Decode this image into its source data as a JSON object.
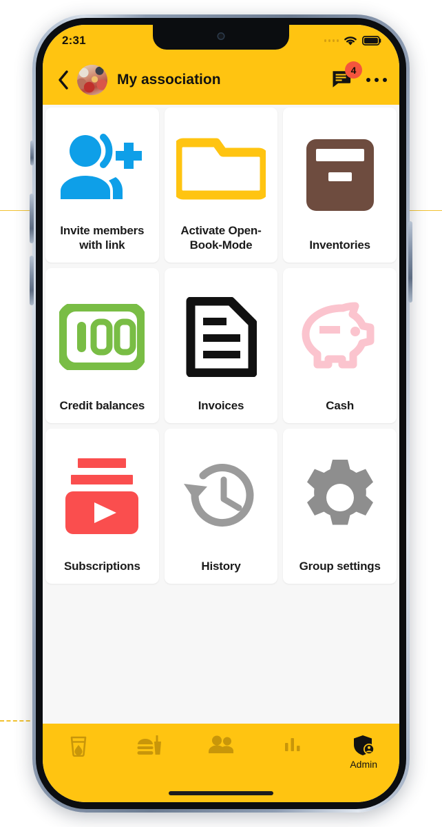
{
  "colors": {
    "brand": "#FFC411",
    "badge": "#F4553D",
    "tile_bg": "#FFFFFF",
    "screen_bg": "#F7F7F7",
    "invite_icon": "#0E9FE8",
    "folder_icon": "#FFC411",
    "inventory_icon": "#6E4C3F",
    "credit_icon": "#79BD45",
    "invoice_icon": "#111111",
    "cash_icon": "#FBC4CE",
    "subscriptions_icon": "#FA4E4E",
    "history_icon": "#9B9B9B",
    "settings_icon": "#8E8E8E",
    "nav_inactive": "#C8960A",
    "nav_active": "#121212"
  },
  "statusbar": {
    "time": "2:31",
    "signal_icon": "signal-dots-icon",
    "wifi_icon": "wifi-icon",
    "battery_icon": "battery-full-icon"
  },
  "appbar": {
    "back_icon": "back-chevron-icon",
    "avatar_icon": "group-avatar-photo",
    "title": "My association",
    "chat_icon": "chat-bubble-icon",
    "chat_badge_count": "4",
    "overflow_icon": "more-horizontal-icon"
  },
  "grid": {
    "tiles": [
      {
        "label": "Invite members with link",
        "icon": "person-add-icon"
      },
      {
        "label": "Activate Open-Book-Mode",
        "icon": "open-folder-icon"
      },
      {
        "label": "Inventories",
        "icon": "archive-box-icon"
      },
      {
        "label": "Credit balances",
        "icon": "hundred-credits-icon"
      },
      {
        "label": "Invoices",
        "icon": "document-lines-icon"
      },
      {
        "label": "Cash",
        "icon": "piggy-bank-icon"
      },
      {
        "label": "Subscriptions",
        "icon": "video-play-stack-icon"
      },
      {
        "label": "History",
        "icon": "history-clock-icon"
      },
      {
        "label": "Group settings",
        "icon": "gear-icon"
      }
    ]
  },
  "bottomnav": {
    "items": [
      {
        "label": "",
        "icon": "drink-glass-icon",
        "active": false
      },
      {
        "label": "",
        "icon": "food-meal-icon",
        "active": false
      },
      {
        "label": "",
        "icon": "people-icon",
        "active": false
      },
      {
        "label": "",
        "icon": "bar-chart-icon",
        "active": false
      },
      {
        "label": "Admin",
        "icon": "admin-shield-icon",
        "active": true
      }
    ]
  }
}
